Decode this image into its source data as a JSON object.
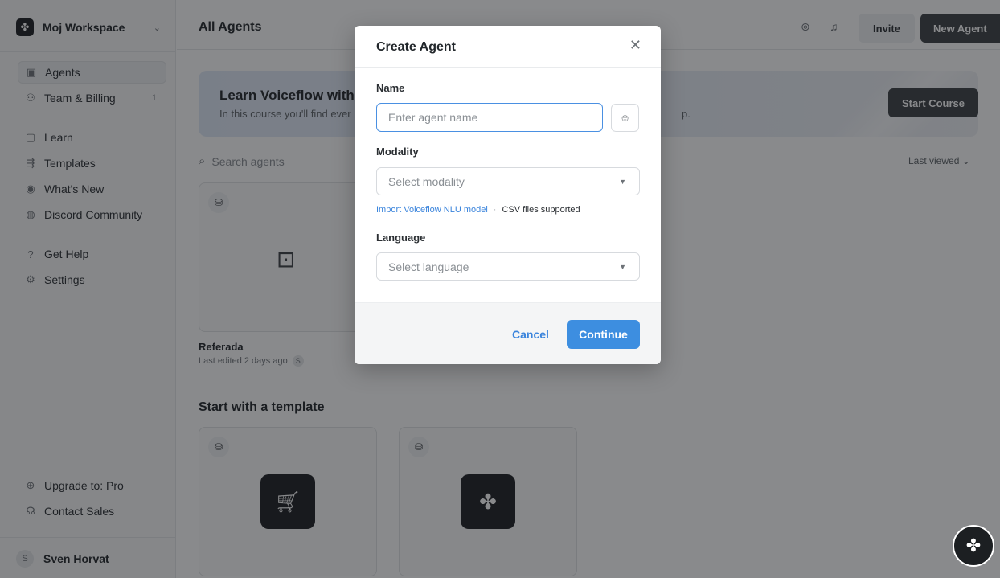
{
  "workspace": {
    "name": "Moj Workspace",
    "logo_icon": "workspace-logo-icon"
  },
  "sidebar": {
    "items": [
      {
        "label": "Agents",
        "icon": "agents-icon",
        "count": ""
      },
      {
        "label": "Team & Billing",
        "icon": "team-icon",
        "count": "1"
      },
      {
        "label": "Learn",
        "icon": "learn-icon",
        "count": ""
      },
      {
        "label": "Templates",
        "icon": "templates-icon",
        "count": ""
      },
      {
        "label": "What's New",
        "icon": "new-icon",
        "count": ""
      },
      {
        "label": "Discord Community",
        "icon": "discord-icon",
        "count": ""
      },
      {
        "label": "Get Help",
        "icon": "help-icon",
        "count": ""
      },
      {
        "label": "Settings",
        "icon": "settings-icon",
        "count": ""
      }
    ],
    "bottom_items": [
      {
        "label": "Upgrade to: Pro",
        "icon": "upgrade-icon"
      },
      {
        "label": "Contact Sales",
        "icon": "contact-icon"
      }
    ],
    "user": {
      "initial": "S",
      "name": "Sven Horvat"
    }
  },
  "header": {
    "title": "All Agents",
    "invite_label": "Invite",
    "new_agent_label": "New Agent"
  },
  "banner": {
    "title": "Learn Voiceflow with v",
    "subtitle": "In this course you'll find ever",
    "subtitle_tail": "p.",
    "button_label": "Start Course"
  },
  "search": {
    "placeholder": "Search agents"
  },
  "sort": {
    "label": "Last viewed"
  },
  "agents": [
    {
      "name": "Referada",
      "meta": "Last edited 2 days ago",
      "owner_initial": "S"
    }
  ],
  "templates_section": {
    "title": "Start with a template"
  },
  "modal": {
    "title": "Create Agent",
    "name_label": "Name",
    "name_placeholder": "Enter agent name",
    "modality_label": "Modality",
    "modality_placeholder": "Select modality",
    "import_link": "Import Voiceflow NLU model",
    "csv_note": "CSV files supported",
    "language_label": "Language",
    "language_placeholder": "Select language",
    "cancel_label": "Cancel",
    "continue_label": "Continue"
  },
  "colors": {
    "primary_blue": "#3d8ee0",
    "link_blue": "#3a84dc",
    "dark": "#1c1f22",
    "overlay": "rgba(20,22,25,0.5)"
  }
}
